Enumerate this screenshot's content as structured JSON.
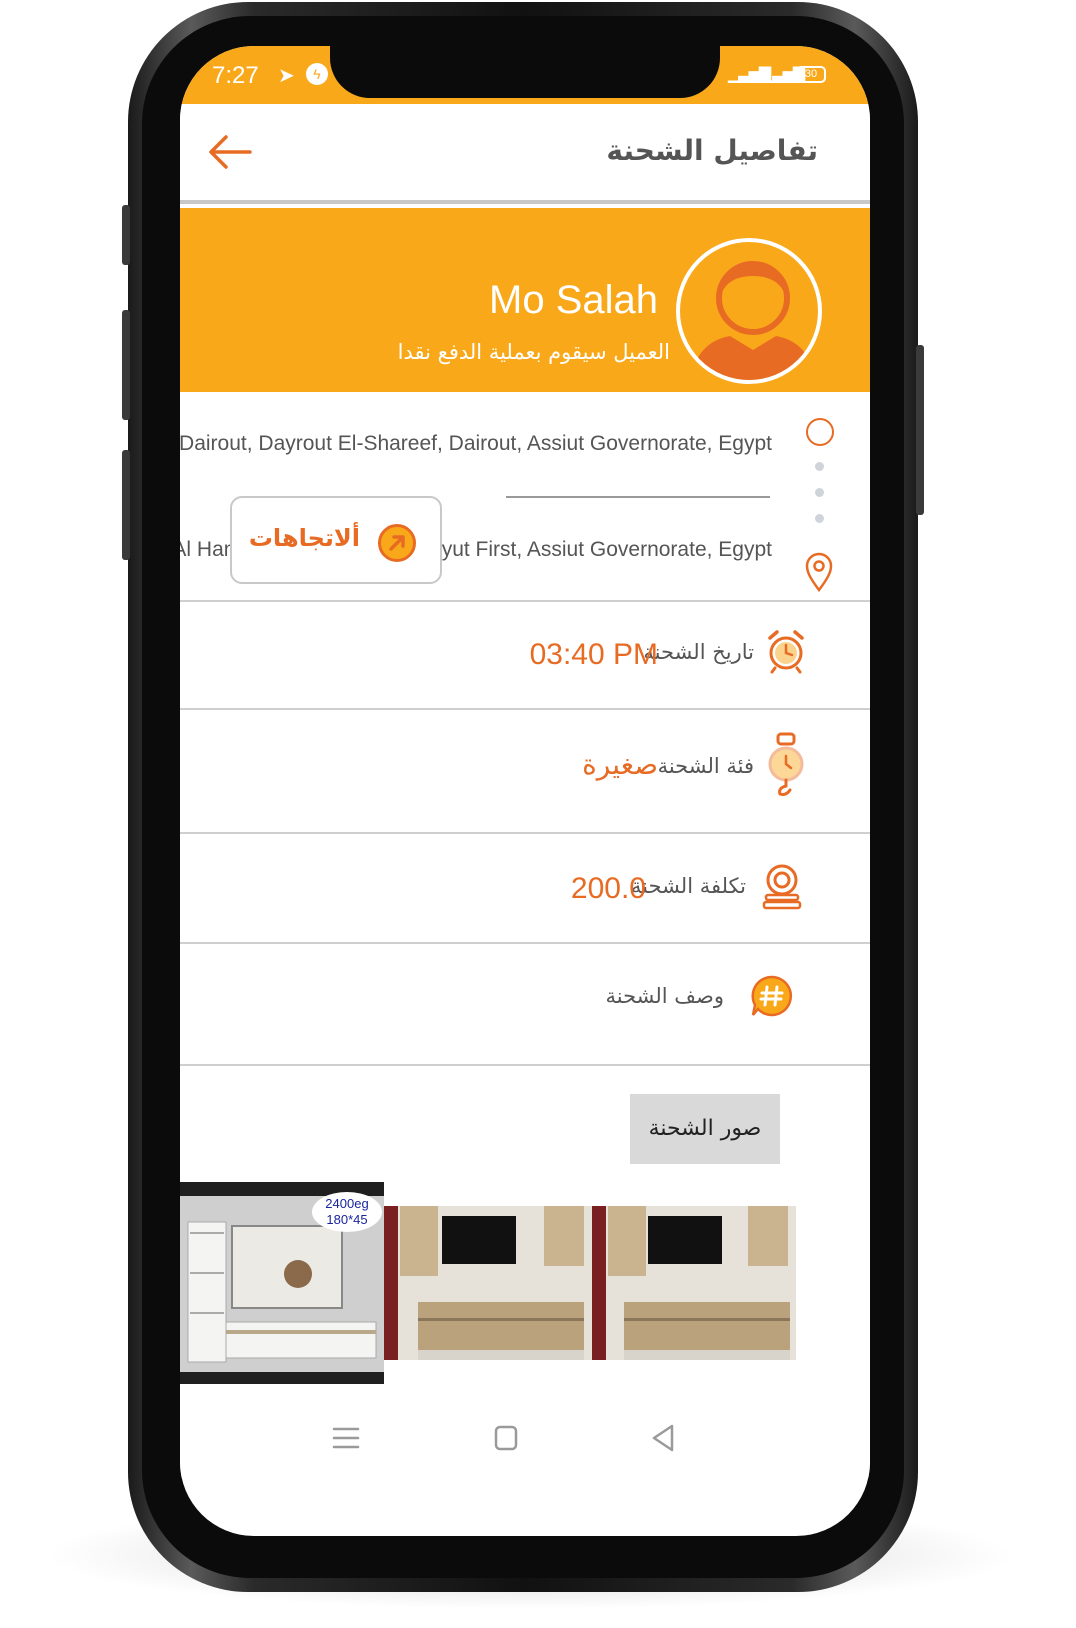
{
  "status_bar": {
    "time": "7:27",
    "battery": "30"
  },
  "app_bar": {
    "title": "تفاصيل الشحنة"
  },
  "customer": {
    "name": "Mo Salah",
    "payment_note": "العميل سيقوم بعملية الدفع نقدا"
  },
  "route": {
    "from_address": "Dairout, Dayrout El-Shareef, Dairout, Assiut Governorate, Egypt",
    "to_address": "Al Hamraa Ath Thaneyah, Asyut First, Assiut Governorate, Egypt",
    "directions_label": "ألاتجاهات"
  },
  "details": {
    "date_label": "تاريخ الشحنة",
    "date_value": "03:40 PM",
    "category_label": "فئة الشحنة",
    "category_value": "صغيرة",
    "cost_label": "تكلفة الشحنة",
    "cost_value": "200.0",
    "description_label": "وصف الشحنة"
  },
  "photos": {
    "button_label": "صور الشحنة",
    "price_tag_line1": "2400eg",
    "price_tag_line2": "180*45"
  },
  "colors": {
    "accent_orange": "#E86B24",
    "banner_yellow": "#F9A81A"
  }
}
